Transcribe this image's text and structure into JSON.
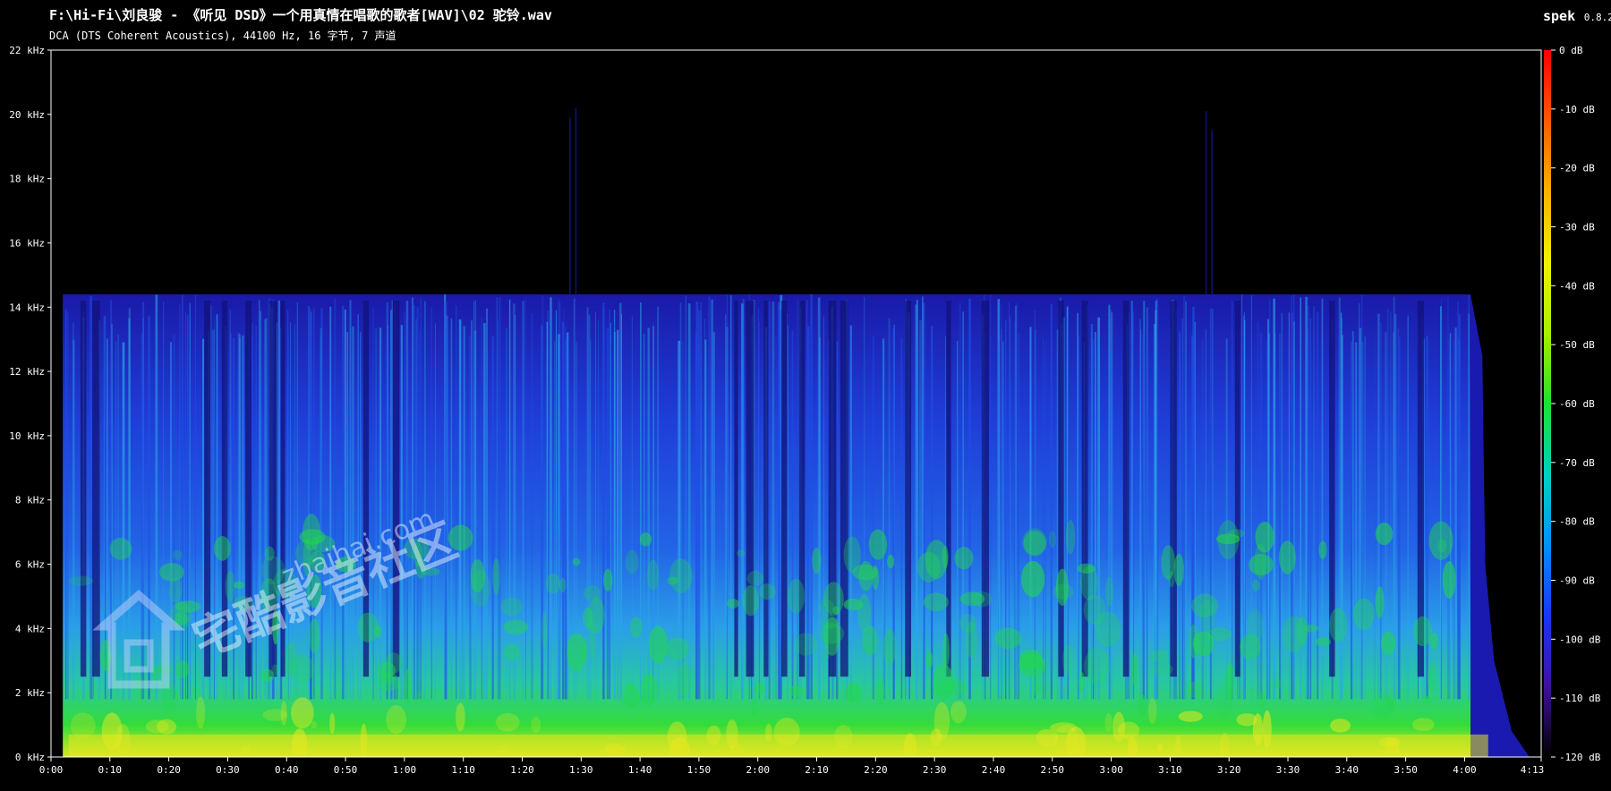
{
  "window": {
    "title": "F:\\Hi-Fi\\刘良骏 - 《听见 DSD》一个用真情在唱歌的歌者[WAV]\\02 驼铃.wav",
    "subtitle": "DCA (DTS Coherent Acoustics), 44100 Hz, 16 字节, 7 声道",
    "app_name": "spek",
    "app_version": "0.8.2"
  },
  "plot": {
    "freq_ticks": [
      "22 kHz",
      "20 kHz",
      "18 kHz",
      "16 kHz",
      "14 kHz",
      "12 kHz",
      "10 kHz",
      "8 kHz",
      "6 kHz",
      "4 kHz",
      "2 kHz",
      "0 kHz"
    ],
    "time_ticks": [
      "0:00",
      "0:10",
      "0:20",
      "0:30",
      "0:40",
      "0:50",
      "1:00",
      "1:10",
      "1:20",
      "1:30",
      "1:40",
      "1:50",
      "2:00",
      "2:10",
      "2:20",
      "2:30",
      "2:40",
      "2:50",
      "3:00",
      "3:10",
      "3:20",
      "3:30",
      "3:40",
      "3:50",
      "4:00"
    ],
    "time_end": "4:13",
    "db_ticks": [
      "0 dB",
      "-10 dB",
      "-20 dB",
      "-30 dB",
      "-40 dB",
      "-50 dB",
      "-60 dB",
      "-70 dB",
      "-80 dB",
      "-90 dB",
      "-100 dB",
      "-110 dB",
      "-120 dB"
    ],
    "spectrum_colors": {
      "background": "#000000",
      "dark_blue": "#1a1ab0",
      "blue": "#1f4fe6",
      "cyan": "#2aa6e8",
      "green": "#22d84a",
      "yellow": "#e8e820"
    },
    "colormap_stops": [
      "#ff0000",
      "#ff6a00",
      "#ffc800",
      "#c8ff00",
      "#20e020",
      "#00c8c8",
      "#0070ff",
      "#2020e0",
      "#400080",
      "#000000"
    ]
  },
  "watermark": {
    "text": "宅酷影音社区",
    "site": "zhaihai.com",
    "icon": "house-logo-icon"
  }
}
